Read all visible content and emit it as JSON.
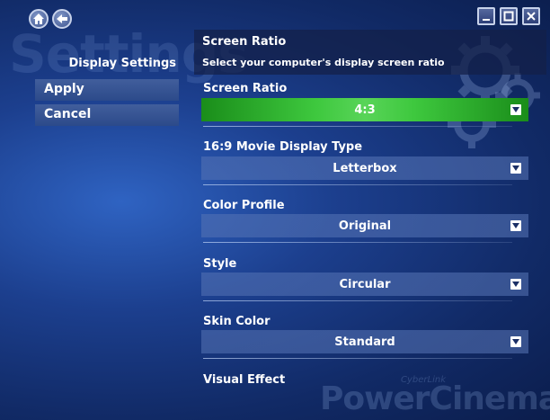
{
  "background": {
    "watermark": "Settings"
  },
  "brand": {
    "small": "CyberLink",
    "name": "PowerCinema"
  },
  "nav": {
    "home_icon": "home-icon",
    "back_icon": "back-arrow-icon"
  },
  "window": {
    "minimize_icon": "minimize-icon",
    "maximize_icon": "maximize-icon",
    "close_icon": "close-icon"
  },
  "sidebar": {
    "title": "Display Settings",
    "items": [
      {
        "label": "Apply"
      },
      {
        "label": "Cancel"
      }
    ]
  },
  "header": {
    "title": "Screen Ratio",
    "description": "Select your computer's display screen ratio"
  },
  "options": [
    {
      "label": "Screen Ratio",
      "value": "4:3",
      "active": true
    },
    {
      "label": "16:9 Movie Display Type",
      "value": "Letterbox"
    },
    {
      "label": "Color Profile",
      "value": "Original"
    },
    {
      "label": "Style",
      "value": "Circular"
    },
    {
      "label": "Skin Color",
      "value": "Standard"
    },
    {
      "label": "Visual Effect",
      "value": ""
    }
  ],
  "colors": {
    "active_green": "#3ec83e",
    "background_blue": "#1c3f8e"
  }
}
